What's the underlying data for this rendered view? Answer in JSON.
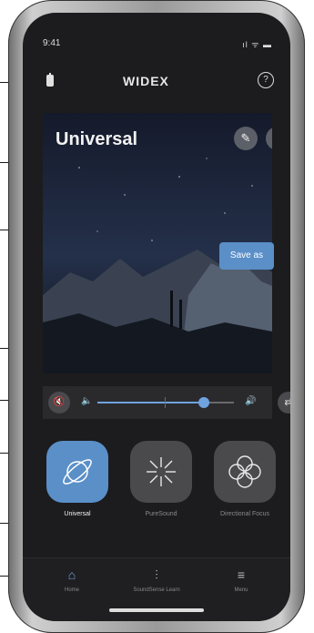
{
  "status_bar": {
    "time": "9:41",
    "icons": "ıl ᯤ ▬"
  },
  "header": {
    "logo": "WIDEX",
    "help_symbol": "?"
  },
  "program_card": {
    "title": "Universal",
    "edit_symbol": "✎",
    "more_symbol": "⋮",
    "save_label": "Save as"
  },
  "volume": {
    "mute_symbol": "🔇",
    "low_symbol": "🔈",
    "high_symbol": "🔊",
    "swap_symbol": "⇄",
    "level": 0.78
  },
  "programs": [
    {
      "label": "Universal",
      "active": true
    },
    {
      "label": "PureSound",
      "active": false
    },
    {
      "label": "Directional Focus",
      "active": false
    }
  ],
  "nav": [
    {
      "label": "Home",
      "symbol": "⌂"
    },
    {
      "label": "SoundSense Learn",
      "symbol": "⫶"
    },
    {
      "label": "Menu",
      "symbol": "≡"
    }
  ],
  "colors": {
    "accent": "#5a8fc8",
    "background": "#1c1c1e"
  }
}
